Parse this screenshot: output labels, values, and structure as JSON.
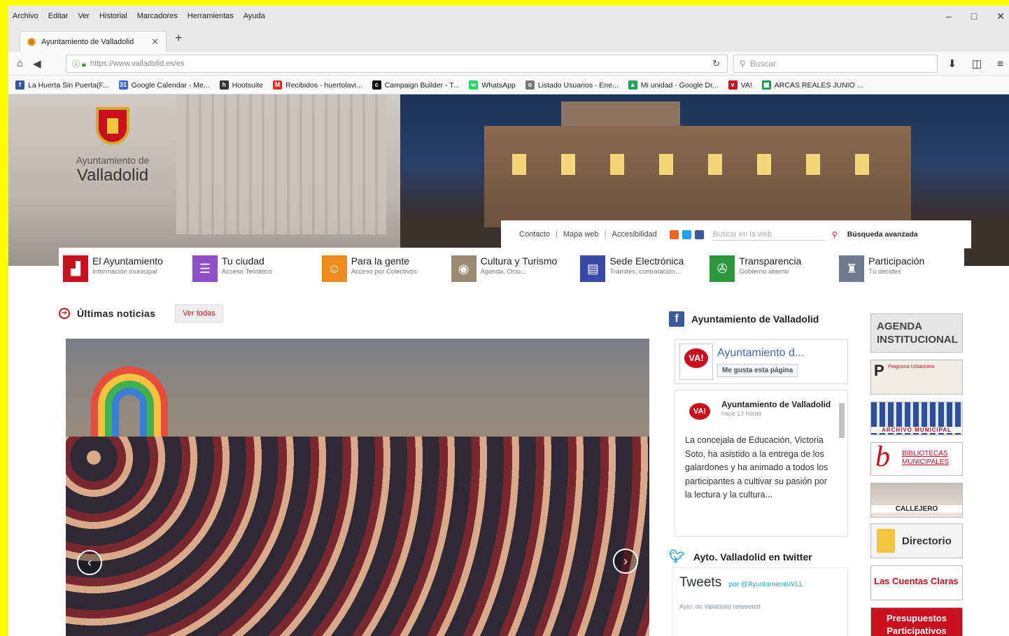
{
  "menubar": {
    "items": [
      "Archivo",
      "Editar",
      "Ver",
      "Historial",
      "Marcadores",
      "Herramientas",
      "Ayuda"
    ]
  },
  "window": {
    "minimize": "–",
    "restore": "□",
    "close": "✕"
  },
  "tab": {
    "title": "Ayuntamiento de Valladolid"
  },
  "nav": {
    "url": "https://www.valladolid.es/es",
    "search_placeholder": "Buscar"
  },
  "bookmarks": [
    {
      "label": "La Huerta Sin Puerta(F...",
      "color": "#3b5998",
      "glyph": "f"
    },
    {
      "label": "Google Calendar - Me...",
      "color": "#3c6bd1",
      "glyph": "31"
    },
    {
      "label": "Hootsuite",
      "color": "#333333",
      "glyph": "h"
    },
    {
      "label": "Recibidos - huertolavi...",
      "color": "#d93025",
      "glyph": "M"
    },
    {
      "label": "Campaign Builder - T...",
      "color": "#111111",
      "glyph": "c"
    },
    {
      "label": "WhatsApp",
      "color": "#25d366",
      "glyph": "w"
    },
    {
      "label": "Listado Usuarios - Ene...",
      "color": "#777777",
      "glyph": "o"
    },
    {
      "label": "Mi unidad - Google Dr...",
      "color": "#1fa463",
      "glyph": "▲"
    },
    {
      "label": "VA!",
      "color": "#c8101e",
      "glyph": "v"
    },
    {
      "label": "ARCAS REALES JUNIO ...",
      "color": "#0f9d58",
      "glyph": "▦"
    }
  ],
  "site": {
    "logo_line1": "Ayuntamiento de",
    "logo_line2": "Valladolid",
    "util": {
      "contact": "Contacto",
      "sitemap": "Mapa web",
      "access": "Accesibilidad",
      "search_placeholder": "Buscar en la web",
      "advanced": "Búsqueda avanzada"
    },
    "nav": [
      {
        "title": "El Ayuntamiento",
        "sub": "Información municipal",
        "color": "#c8101e",
        "glyph": "▟"
      },
      {
        "title": "Tu ciudad",
        "sub": "Acceso Temático",
        "color": "#8e4fc7",
        "glyph": "☰"
      },
      {
        "title": "Para la gente",
        "sub": "Acceso por Colectivos",
        "color": "#f08a1c",
        "glyph": "☺"
      },
      {
        "title": "Cultura y Turismo",
        "sub": "Agenda, Ocio...",
        "color": "#9a8a70",
        "glyph": "◉"
      },
      {
        "title": "Sede Electrónica",
        "sub": "Trámites, contratación...",
        "color": "#3b49a8",
        "glyph": "▤"
      },
      {
        "title": "Transparencia",
        "sub": "Gobierno abierto",
        "color": "#2a9a3c",
        "glyph": "✇"
      },
      {
        "title": "Participación",
        "sub": "Tú decides",
        "color": "#6d7b8c",
        "glyph": "♜"
      }
    ],
    "news": {
      "title": "Últimas noticias",
      "see_all": "Ver todas"
    },
    "facebook": {
      "header": "Ayuntamiento de Valladolid",
      "page_name": "Ayuntamiento d...",
      "like": "Me gusta esta página",
      "badge": "VA!",
      "post_author": "Ayuntamiento de Valladolid",
      "post_time": "hace 13 horas",
      "post_text": "La concejala de Educación, Victoria Soto, ha asistido a la entrega de los galardones y ha animado a todos los participantes a cultivar su pasión por la lectura y la cultura..."
    },
    "twitter": {
      "header": "Ayto. Valladolid en twitter",
      "tweets": "Tweets",
      "by": "por @AyuntamientoVLL",
      "retweet": "Ayto. de Valladolid retweeted"
    },
    "banners": {
      "agenda": "AGENDA INSTITUCIONAL",
      "pp": "Programa Urbanismo",
      "archivo": "ARCHIVO MUNICIPAL",
      "bibliotecas": "BIBLIOTECAS MUNICIPALES",
      "callejero": "CALLEJERO",
      "directorio": "Directorio",
      "cuentas": "Las Cuentas Claras",
      "presupuestos": "Presupuestos Participativos"
    }
  }
}
